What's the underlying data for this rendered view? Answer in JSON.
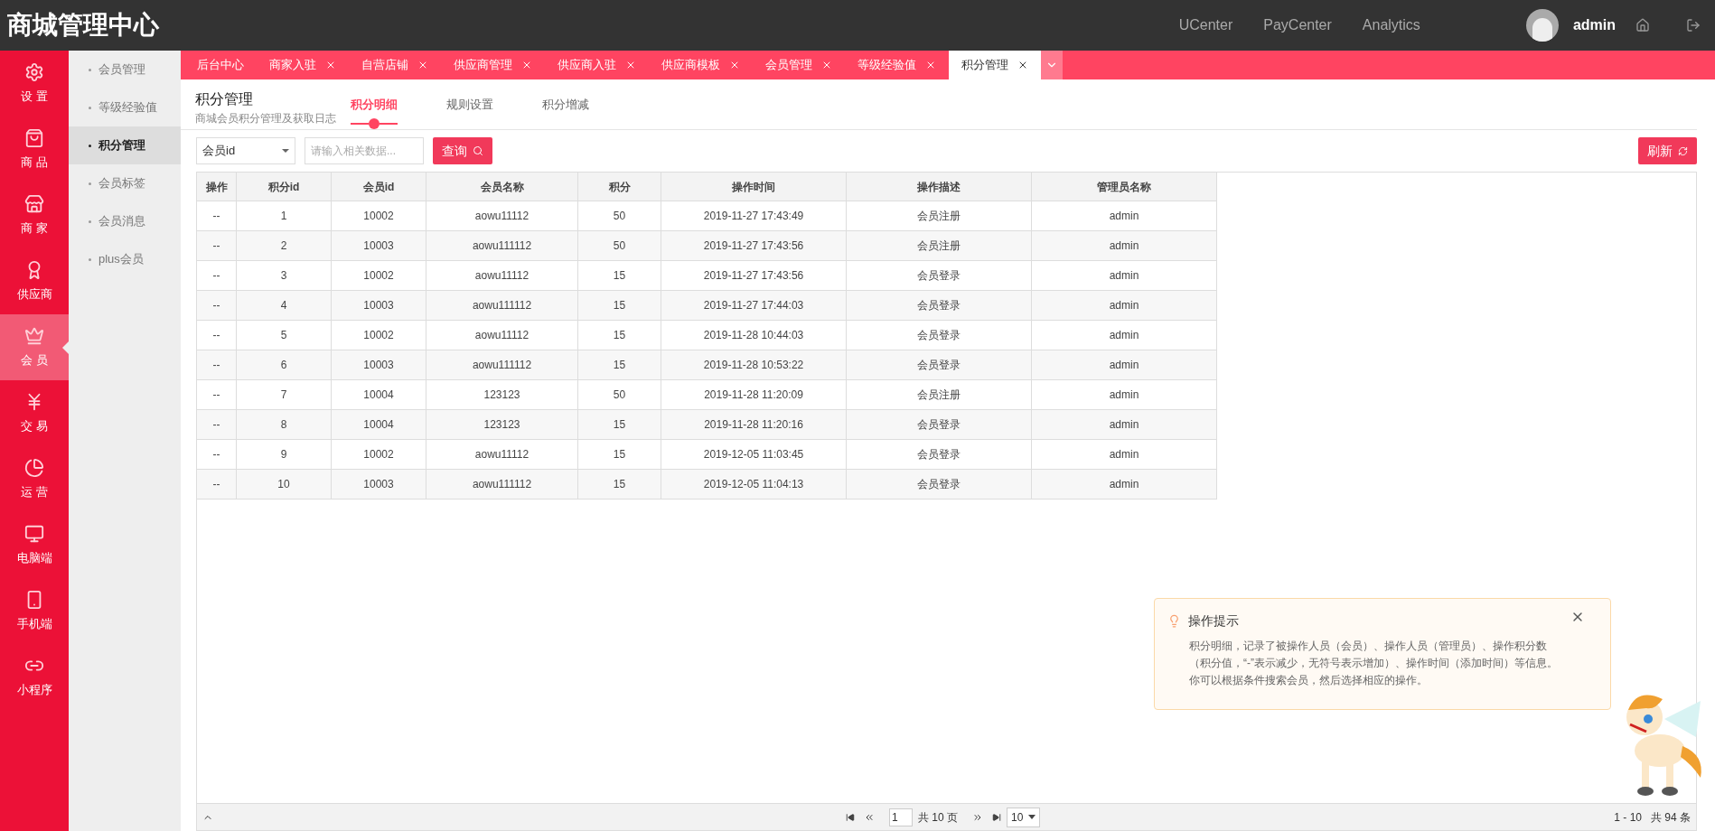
{
  "header": {
    "title": "商城管理中心",
    "links": [
      "UCenter",
      "PayCenter",
      "Analytics"
    ],
    "user": "admin"
  },
  "nav": [
    {
      "label": "设 置",
      "selected": false
    },
    {
      "label": "商 品",
      "selected": false
    },
    {
      "label": "商 家",
      "selected": false
    },
    {
      "label": "供应商",
      "selected": false
    },
    {
      "label": "会 员",
      "selected": true
    },
    {
      "label": "交 易",
      "selected": false
    },
    {
      "label": "运 营",
      "selected": false
    },
    {
      "label": "电脑端",
      "selected": false
    },
    {
      "label": "手机端",
      "selected": false
    },
    {
      "label": "小程序",
      "selected": false
    }
  ],
  "subnav": [
    {
      "label": "会员管理",
      "selected": false
    },
    {
      "label": "等级经验值",
      "selected": false
    },
    {
      "label": "积分管理",
      "selected": true
    },
    {
      "label": "会员标签",
      "selected": false
    },
    {
      "label": "会员消息",
      "selected": false
    },
    {
      "label": "plus会员",
      "selected": false
    }
  ],
  "tabs": [
    {
      "label": "后台中心",
      "closable": false,
      "selected": false
    },
    {
      "label": "商家入驻",
      "closable": true,
      "selected": false
    },
    {
      "label": "自营店铺",
      "closable": true,
      "selected": false
    },
    {
      "label": "供应商管理",
      "closable": true,
      "selected": false
    },
    {
      "label": "供应商入驻",
      "closable": true,
      "selected": false
    },
    {
      "label": "供应商模板",
      "closable": true,
      "selected": false
    },
    {
      "label": "会员管理",
      "closable": true,
      "selected": false
    },
    {
      "label": "等级经验值",
      "closable": true,
      "selected": false
    },
    {
      "label": "积分管理",
      "closable": true,
      "selected": true
    }
  ],
  "page": {
    "title": "积分管理",
    "subtitle": "商城会员积分管理及获取日志"
  },
  "subtabs": [
    {
      "label": "积分明细",
      "selected": true
    },
    {
      "label": "规则设置",
      "selected": false
    },
    {
      "label": "积分增减",
      "selected": false
    }
  ],
  "search": {
    "field": "会员id",
    "placeholder": "请输入相关数据...",
    "button": "查询"
  },
  "refresh": "刷新",
  "table": {
    "columns": [
      "操作",
      "积分id",
      "会员id",
      "会员名称",
      "积分",
      "操作时间",
      "操作描述",
      "管理员名称"
    ],
    "rows": [
      [
        "--",
        "1",
        "10002",
        "aowu11112",
        "50",
        "2019-11-27 17:43:49",
        "会员注册",
        "admin"
      ],
      [
        "--",
        "2",
        "10003",
        "aowu111112",
        "50",
        "2019-11-27 17:43:56",
        "会员注册",
        "admin"
      ],
      [
        "--",
        "3",
        "10002",
        "aowu11112",
        "15",
        "2019-11-27 17:43:56",
        "会员登录",
        "admin"
      ],
      [
        "--",
        "4",
        "10003",
        "aowu111112",
        "15",
        "2019-11-27 17:44:03",
        "会员登录",
        "admin"
      ],
      [
        "--",
        "5",
        "10002",
        "aowu11112",
        "15",
        "2019-11-28 10:44:03",
        "会员登录",
        "admin"
      ],
      [
        "--",
        "6",
        "10003",
        "aowu111112",
        "15",
        "2019-11-28 10:53:22",
        "会员登录",
        "admin"
      ],
      [
        "--",
        "7",
        "10004",
        "123123",
        "50",
        "2019-11-28 11:20:09",
        "会员注册",
        "admin"
      ],
      [
        "--",
        "8",
        "10004",
        "123123",
        "15",
        "2019-11-28 11:20:16",
        "会员登录",
        "admin"
      ],
      [
        "--",
        "9",
        "10002",
        "aowu11112",
        "15",
        "2019-12-05 11:03:45",
        "会员登录",
        "admin"
      ],
      [
        "--",
        "10",
        "10003",
        "aowu111112",
        "15",
        "2019-12-05 11:04:13",
        "会员登录",
        "admin"
      ]
    ]
  },
  "pager": {
    "page": "1",
    "total_pages": "共 10 页",
    "page_size": "10",
    "range": "1 - 10",
    "total": "共 94 条"
  },
  "tip": {
    "title": "操作提示",
    "lines": [
      "积分明细，记录了被操作人员（会员）、操作人员（管理员）、操作积分数（积分值，“-”表示减少，无符号表示增加）、操作时间（添加时间）等信息。",
      "你可以根据条件搜索会员，然后选择相应的操作。"
    ]
  }
}
